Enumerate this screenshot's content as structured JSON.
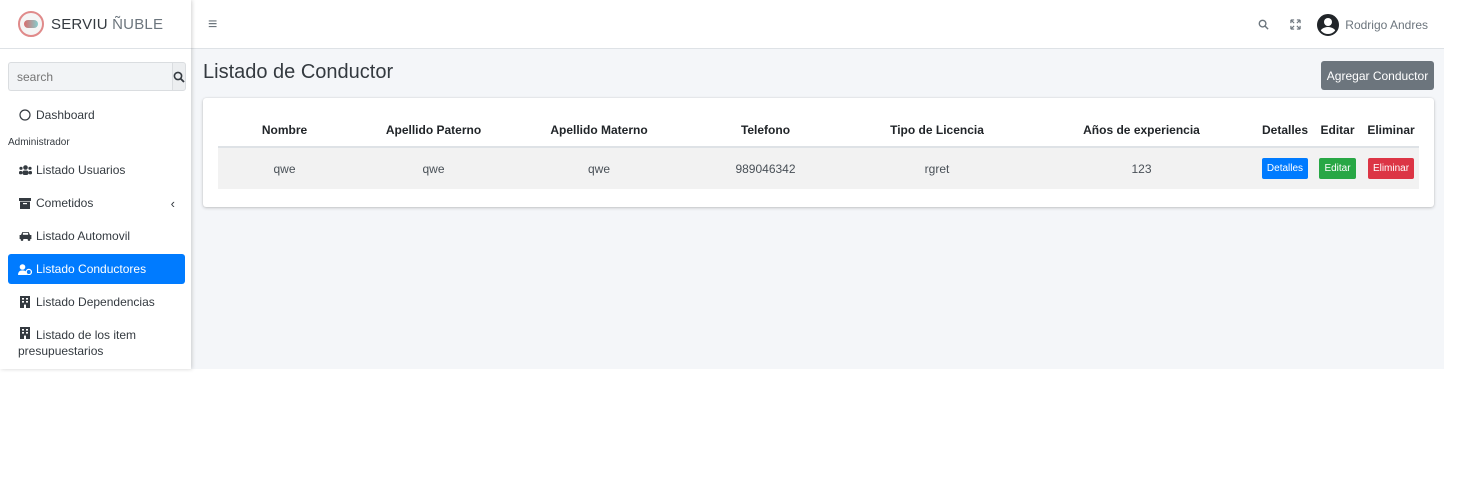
{
  "brand": {
    "name_bold": "SERVIU",
    "name_light": " ÑUBLE"
  },
  "search": {
    "placeholder": "search"
  },
  "sidebar": {
    "dashboard": "Dashboard",
    "header_admin": "Administrador",
    "items": [
      {
        "label": "Listado Usuarios",
        "icon": "users-icon"
      },
      {
        "label": "Cometidos",
        "icon": "archive-icon"
      },
      {
        "label": "Listado Automovil",
        "icon": "car-icon"
      },
      {
        "label": "Listado Conductores",
        "icon": "user-tie-icon"
      },
      {
        "label": "Listado Dependencias",
        "icon": "building-icon"
      },
      {
        "label": "Listado de los item",
        "label2": "presupuestarios",
        "icon": "building-icon"
      }
    ]
  },
  "topbar": {
    "user_name": "Rodrigo Andres"
  },
  "main": {
    "title": "Listado de Conductor",
    "add_button": "Agregar Conductor",
    "table": {
      "headers": [
        "Nombre",
        "Apellido Paterno",
        "Apellido Materno",
        "Telefono",
        "Tipo de Licencia",
        "Años de experiencia",
        "Detalles",
        "Editar",
        "Eliminar"
      ],
      "rows": [
        {
          "nombre": "qwe",
          "apellido_paterno": "qwe",
          "apellido_materno": "qwe",
          "telefono": "989046342",
          "tipo_licencia": "rgret",
          "anios_experiencia": "123",
          "detalles": "Detalles",
          "editar": "Editar",
          "eliminar": "Eliminar"
        }
      ]
    }
  },
  "colors": {
    "primary": "#007bff",
    "secondary": "#6c757d",
    "success": "#28a745",
    "danger": "#dc3545",
    "background": "#f4f6f9"
  }
}
